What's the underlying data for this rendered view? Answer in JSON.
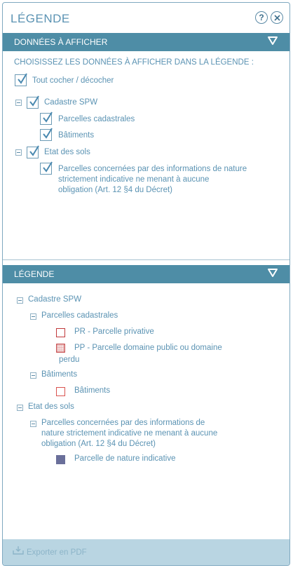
{
  "dialog": {
    "title": "LÉGENDE"
  },
  "header": {
    "help_icon": "question-circle",
    "close_icon": "x-circle"
  },
  "data_section": {
    "title": "DONNÉES À AFFICHER",
    "instruction": "CHOISISSEZ LES DONNÉES À AFFICHER DANS LA LÉGENDE :",
    "toggle_all": {
      "label": "Tout cocher / décocher",
      "checked": true
    },
    "groups": [
      {
        "label": "Cadastre SPW",
        "checked": true,
        "items": [
          {
            "label": "Parcelles cadastrales",
            "checked": true
          },
          {
            "label": "Bâtiments",
            "checked": true
          }
        ]
      },
      {
        "label": "Etat des sols",
        "checked": true,
        "items": [
          {
            "label_lines": [
              "Parcelles concernées par des informations de nature",
              "strictement indicative ne menant à aucune",
              "obligation (Art. 12 §4 du Décret)"
            ],
            "checked": true
          }
        ]
      }
    ]
  },
  "legend_section": {
    "title": "LÉGENDE",
    "groups": [
      {
        "label": "Cadastre SPW",
        "layers": [
          {
            "label": "Parcelles cadastrales",
            "entries": [
              {
                "label": "PR - Parcelle privative",
                "swatch": "outline-red"
              },
              {
                "label_lines": [
                  "PP - Parcelle domaine public ou domaine",
                  "perdu"
                ],
                "swatch": "hatched-red"
              }
            ]
          },
          {
            "label": "Bâtiments",
            "entries": [
              {
                "label": "Bâtiments",
                "swatch": "outline-red-light"
              }
            ]
          }
        ]
      },
      {
        "label": "Etat des sols",
        "layers": [
          {
            "label_lines": [
              "Parcelles concernées par des informations de",
              "nature strictement indicative ne menant à aucune",
              "obligation (Art. 12 §4 du Décret)"
            ],
            "entries": [
              {
                "label": "Parcelle de nature indicative",
                "swatch": "filled-slate"
              }
            ]
          }
        ]
      }
    ]
  },
  "footer": {
    "export_label": "Exporter en PDF",
    "export_icon": "download-tray"
  },
  "colors": {
    "accent": "#4e8da6",
    "text": "#5b93b3",
    "swatch_red": "#c0393b",
    "swatch_slate": "#6a6f9a",
    "footer_bg": "#b9d5e2"
  }
}
